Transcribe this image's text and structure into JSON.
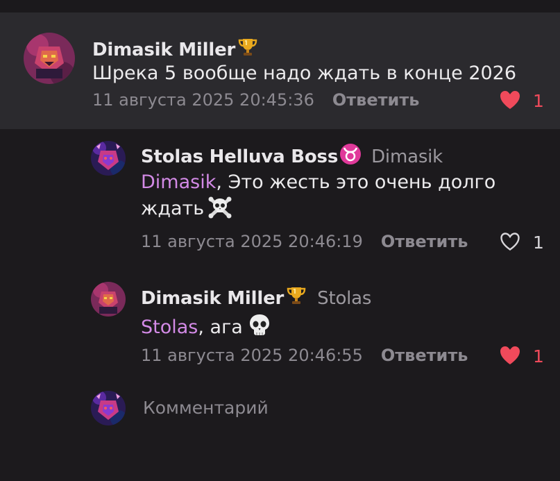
{
  "comments": [
    {
      "author": "Dimasik Miller",
      "badge": "trophy-icon",
      "reply_to": "",
      "mention": "",
      "text": "Шрека 5 вообще надо ждать в конце 2026",
      "timestamp": "11 августа 2025 20:45:36",
      "reply_label": "Ответить",
      "likes": "1",
      "liked": true
    },
    {
      "author": "Stolas Helluva Boss",
      "badge": "taurus-icon",
      "reply_to": "Dimasik",
      "mention": "Dimasik",
      "text_line1": ", Это жесть это очень долго",
      "text_line2": "ждать",
      "emoji": "skull-crossbones-icon",
      "timestamp": "11 августа 2025 20:46:19",
      "reply_label": "Ответить",
      "likes": "1",
      "liked": false
    },
    {
      "author": "Dimasik Miller",
      "badge": "trophy-icon",
      "reply_to": "Stolas",
      "mention": "Stolas",
      "text": ", ага",
      "emoji": "skull-icon",
      "timestamp": "11 августа 2025 20:46:55",
      "reply_label": "Ответить",
      "likes": "1",
      "liked": true
    }
  ],
  "composer": {
    "placeholder": "Комментарий"
  },
  "colors": {
    "background": "#1c1a1d",
    "highlight": "#2b2a2e",
    "mention": "#d38ae6",
    "like_active": "#f04a5b",
    "muted": "#8d8a91"
  }
}
